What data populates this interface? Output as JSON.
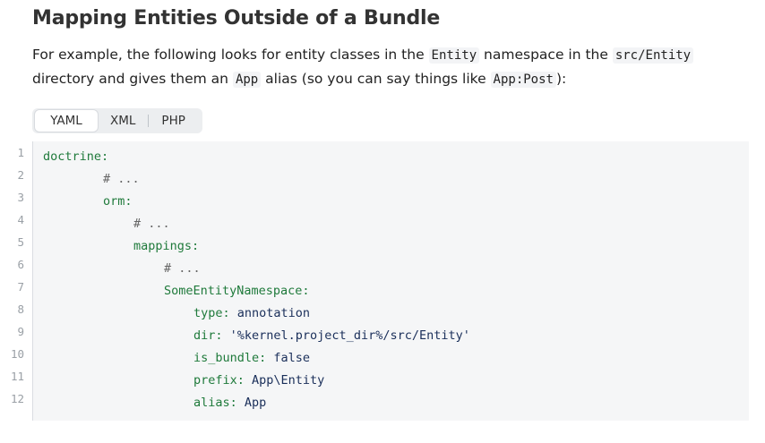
{
  "heading": "Mapping Entities Outside of a Bundle",
  "paragraph": {
    "t1": "For example, the following looks for entity classes in the ",
    "c1": "Entity",
    "t2": " namespace in the ",
    "c2": "src/Entity",
    "t3": " directory and gives them an ",
    "c3": "App",
    "t4": " alias (so you can say things like ",
    "c4": "App:Post",
    "t5": "):"
  },
  "tabs": [
    {
      "label": "YAML",
      "active": true
    },
    {
      "label": "XML",
      "active": false
    },
    {
      "label": "PHP",
      "active": false
    }
  ],
  "code": {
    "line_numbers": [
      "1",
      "2",
      "3",
      "4",
      "5",
      "6",
      "7",
      "8",
      "9",
      "10",
      "11",
      "12"
    ],
    "l1_key": "doctrine:",
    "l2_comment": "# ...",
    "l3_key": "orm:",
    "l4_comment": "# ...",
    "l5_key": "mappings:",
    "l6_comment": "# ...",
    "l7_key": "SomeEntityNamespace:",
    "l8_key": "type:",
    "l8_val": " annotation",
    "l9_key": "dir:",
    "l9_val": " '%kernel.project_dir%/src/Entity'",
    "l10_key": "is_bundle:",
    "l10_val": " false",
    "l11_key": "prefix:",
    "l11_val": " App\\Entity",
    "l12_key": "alias:",
    "l12_val": " App"
  }
}
